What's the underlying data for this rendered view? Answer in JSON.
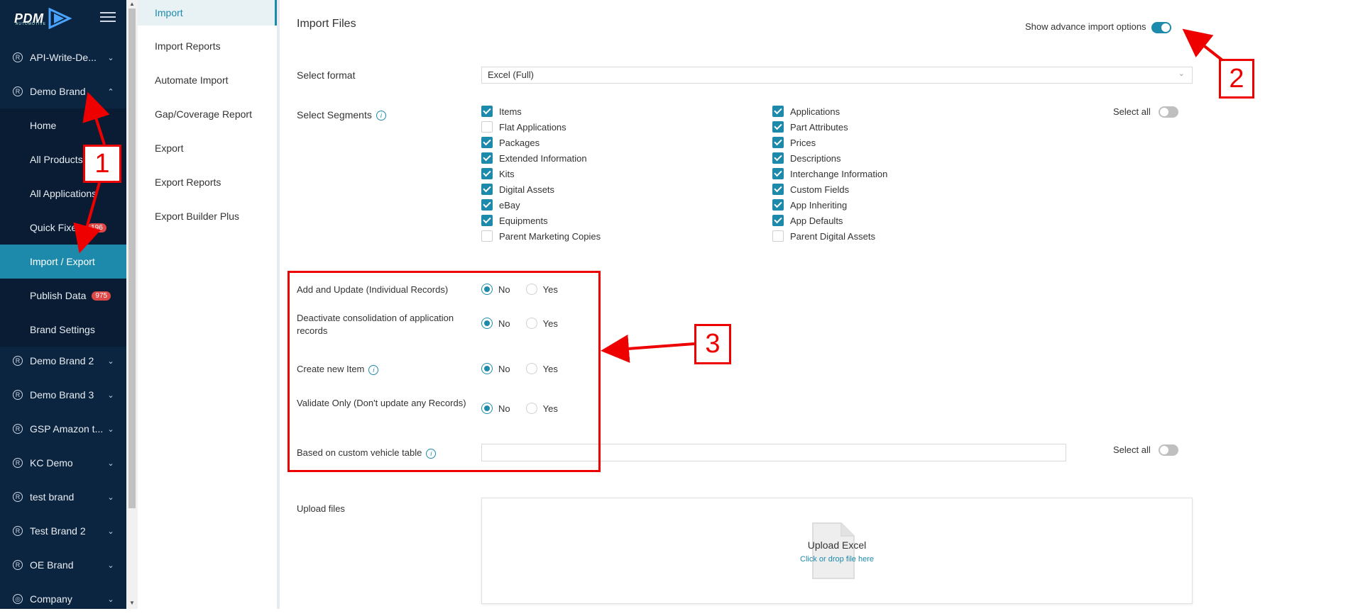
{
  "brand": {
    "logo_text": "PDM",
    "logo_sub": "AUTOMOTIVE"
  },
  "sidebar": {
    "items": [
      {
        "label": "API-Write-De...",
        "icon": "registered-icon"
      },
      {
        "label": "Demo Brand",
        "icon": "registered-icon"
      },
      {
        "label": "Demo Brand 2",
        "icon": "registered-icon"
      },
      {
        "label": "Demo Brand 3",
        "icon": "registered-icon"
      },
      {
        "label": "GSP Amazon t...",
        "icon": "registered-icon"
      },
      {
        "label": "KC Demo",
        "icon": "registered-icon"
      },
      {
        "label": "test brand",
        "icon": "registered-icon"
      },
      {
        "label": "Test Brand 2",
        "icon": "registered-icon"
      },
      {
        "label": "OE Brand",
        "icon": "registered-icon"
      },
      {
        "label": "Company",
        "icon": "globe-icon"
      }
    ],
    "sub_items": [
      {
        "label": "Home"
      },
      {
        "label": "All Products"
      },
      {
        "label": "All Applications"
      },
      {
        "label": "Quick Fixes",
        "badge": "196"
      },
      {
        "label": "Import / Export"
      },
      {
        "label": "Publish Data",
        "badge": "975"
      },
      {
        "label": "Brand Settings"
      }
    ]
  },
  "submenu": {
    "items": [
      "Import",
      "Import Reports",
      "Automate Import",
      "Gap/Coverage Report",
      "Export",
      "Export Reports",
      "Export Builder Plus"
    ]
  },
  "main": {
    "title": "Import Files",
    "advance_label": "Show advance import options",
    "select_format_label": "Select format",
    "select_format_value": "Excel (Full)",
    "select_segments_label": "Select Segments",
    "select_all_label": "Select all",
    "segments_left": [
      {
        "label": "Items",
        "checked": true
      },
      {
        "label": "Flat Applications",
        "checked": false
      },
      {
        "label": "Packages",
        "checked": true
      },
      {
        "label": "Extended Information",
        "checked": true
      },
      {
        "label": "Kits",
        "checked": true
      },
      {
        "label": "Digital Assets",
        "checked": true
      },
      {
        "label": "eBay",
        "checked": true
      },
      {
        "label": "Equipments",
        "checked": true
      },
      {
        "label": "Parent Marketing Copies",
        "checked": false
      }
    ],
    "segments_right": [
      {
        "label": "Applications",
        "checked": true
      },
      {
        "label": "Part Attributes",
        "checked": true
      },
      {
        "label": "Prices",
        "checked": true
      },
      {
        "label": "Descriptions",
        "checked": true
      },
      {
        "label": "Interchange Information",
        "checked": true
      },
      {
        "label": "Custom Fields",
        "checked": true
      },
      {
        "label": "App Inheriting",
        "checked": true
      },
      {
        "label": "App Defaults",
        "checked": true
      },
      {
        "label": "Parent Digital Assets",
        "checked": false
      }
    ],
    "options": [
      {
        "label": "Add and Update (Individual Records)",
        "selected": "No"
      },
      {
        "label": "Deactivate consolidation of application records",
        "selected": "No"
      },
      {
        "label": "Create new Item",
        "selected": "No"
      },
      {
        "label": "Validate Only (Don't update any Records)",
        "selected": "No"
      }
    ],
    "no_label": "No",
    "yes_label": "Yes",
    "custom_vehicle_label": "Based on custom vehicle table",
    "upload_label": "Upload files",
    "upload_title": "Upload Excel",
    "upload_hint": "Click or drop file here"
  },
  "annotations": {
    "one": "1",
    "two": "2",
    "three": "3"
  },
  "colors": {
    "accent": "#1d8aab",
    "sidebar": "#0b2440",
    "annotation": "#ee0000",
    "badge": "#e04848"
  }
}
